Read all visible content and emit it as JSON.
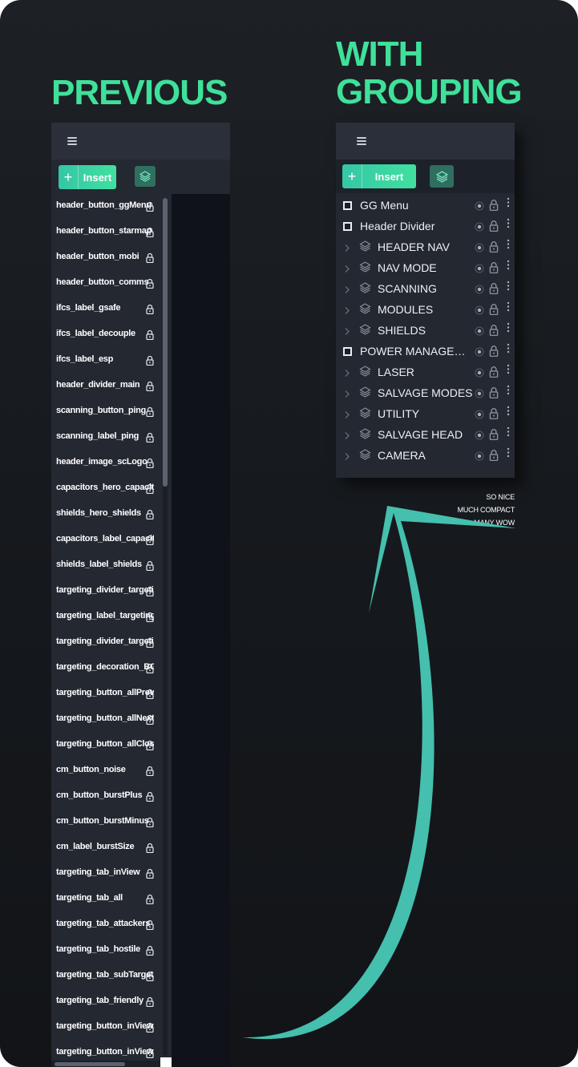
{
  "headings": {
    "previous": "PREVIOUS",
    "with_line1": "WITH",
    "with_line2": "GROUPING"
  },
  "toolbar": {
    "insert_label": "Insert"
  },
  "colors": {
    "accent_green": "#3fe19a",
    "panel_bg": "#232831",
    "arrow_teal": "#45bfae"
  },
  "left_list": [
    "header_button_ggMenu",
    "header_button_starmap",
    "header_button_mobi",
    "header_button_comms",
    "ifcs_label_gsafe",
    "ifcs_label_decouple",
    "ifcs_label_esp",
    "header_divider_main",
    "scanning_button_ping",
    "scanning_label_ping",
    "header_image_scLogo",
    "capacitors_hero_capacitors",
    "shields_hero_shields",
    "capacitors_label_capacitors",
    "shields_label_shields",
    "targeting_divider_targeting",
    "targeting_label_targeting",
    "targeting_divider_targeting",
    "targeting_decoration_BG",
    "targeting_button_allPrev",
    "targeting_button_allNext",
    "targeting_button_allClose",
    "cm_button_noise",
    "cm_button_burstPlus",
    "cm_button_burstMinus",
    "cm_label_burstSize",
    "targeting_tab_inView",
    "targeting_tab_all",
    "targeting_tab_attackers",
    "targeting_tab_hostile",
    "targeting_tab_subTarget",
    "targeting_tab_friendly",
    "targeting_button_inViewPrev",
    "targeting_button_inViewNext"
  ],
  "right_list": [
    {
      "label": "GG Menu",
      "kind": "frame"
    },
    {
      "label": "Header Divider",
      "kind": "frame"
    },
    {
      "label": "HEADER NAV",
      "kind": "group"
    },
    {
      "label": "NAV MODE",
      "kind": "group"
    },
    {
      "label": "SCANNING",
      "kind": "group"
    },
    {
      "label": "MODULES",
      "kind": "group"
    },
    {
      "label": "SHIELDS",
      "kind": "group"
    },
    {
      "label": "POWER MANAGEMENT",
      "kind": "frame"
    },
    {
      "label": "LASER",
      "kind": "group"
    },
    {
      "label": "SALVAGE MODES",
      "kind": "group"
    },
    {
      "label": "UTILITY",
      "kind": "group"
    },
    {
      "label": "SALVAGE HEAD",
      "kind": "group"
    },
    {
      "label": "CAMERA",
      "kind": "group"
    }
  ],
  "note": {
    "line1": "SO NICE",
    "line2": "MUCH COMPACT",
    "line3": "MANY WOW"
  }
}
